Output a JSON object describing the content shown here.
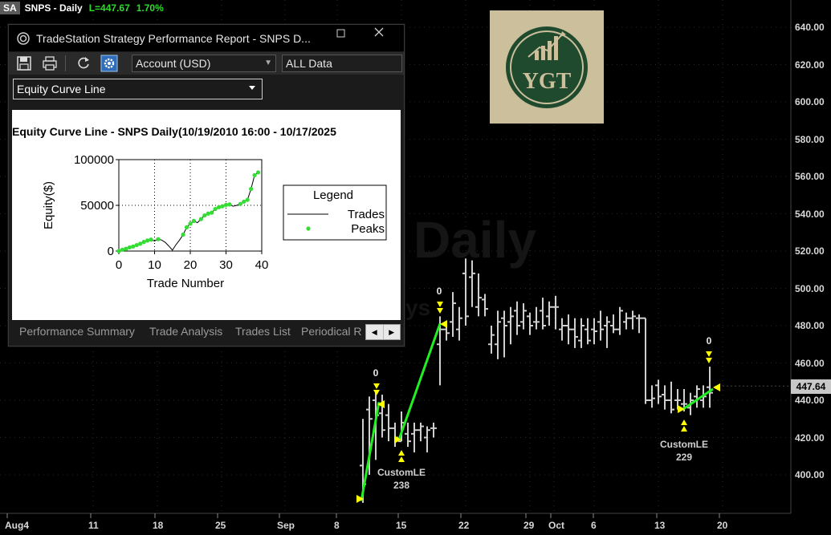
{
  "chart_header": {
    "badge": "SA",
    "symbol": "SNPS - Daily",
    "last": "L=447.67",
    "change": "1.70%"
  },
  "price_axis": [
    "640.00",
    "620.00",
    "600.00",
    "580.00",
    "560.00",
    "540.00",
    "520.00",
    "500.00",
    "480.00",
    "460.00",
    "440.00",
    "420.00",
    "400.00"
  ],
  "current_price": "447.64",
  "date_axis": [
    "Aug4",
    "11",
    "18",
    "25",
    "Sep",
    "8",
    "15",
    "22",
    "29",
    "Oct",
    "6",
    "13",
    "20"
  ],
  "watermark": "Daily",
  "watermark2": "ys",
  "logo_text": "YGT",
  "signals": [
    {
      "label": "CustomLE",
      "qty": "238",
      "zero": "0"
    },
    {
      "label": "",
      "qty": "",
      "zero": "0"
    },
    {
      "label": "CustomLE",
      "qty": "229",
      "zero": "0"
    }
  ],
  "window": {
    "title": "TradeStation Strategy Performance Report - SNPS D...",
    "account": "Account (USD)",
    "data_range": "ALL Data",
    "curve_type": "Equity Curve Line",
    "tabs": [
      "Performance Summary",
      "Trade Analysis",
      "Trades List",
      "Periodical R"
    ]
  },
  "colors": {
    "peak": "#33dd33",
    "entry_line": "#22ee22",
    "arrow": "#ffff00",
    "bar": "#cccccc"
  },
  "chart_data": {
    "type": "line",
    "title": "Equity Curve Line - SNPS Daily(10/19/2010 16:00 - 10/17/2025",
    "xlabel": "Trade Number",
    "ylabel": "Equity($)",
    "xlim": [
      0,
      40
    ],
    "ylim": [
      0,
      100000
    ],
    "xticks": [
      "0",
      "10",
      "20",
      "30",
      "40"
    ],
    "yticks": [
      "0",
      "50000",
      "100000"
    ],
    "legend_title": "Legend",
    "legend_placement": "right",
    "series": [
      {
        "name": "Trades",
        "x": [
          0,
          1,
          2,
          3,
          4,
          5,
          6,
          7,
          8,
          9,
          10,
          11,
          12,
          13,
          14,
          15,
          16,
          17,
          18,
          19,
          20,
          21,
          22,
          23,
          24,
          25,
          26,
          27,
          28,
          29,
          30,
          31,
          32,
          33,
          34,
          35,
          36,
          37,
          38,
          39
        ],
        "values": [
          0,
          1500,
          2500,
          4000,
          5000,
          6500,
          8000,
          10000,
          11500,
          12500,
          11000,
          13000,
          12000,
          9500,
          5500,
          1000,
          7000,
          12000,
          18000,
          26000,
          30000,
          33000,
          31000,
          35000,
          39000,
          41000,
          42000,
          46000,
          48000,
          49000,
          50500,
          51000,
          49000,
          50000,
          51500,
          54000,
          56000,
          68000,
          83000,
          86000
        ]
      },
      {
        "name": "Peaks",
        "x": [
          0,
          1,
          2,
          3,
          4,
          5,
          6,
          7,
          8,
          9,
          11,
          18,
          19,
          20,
          21,
          23,
          24,
          25,
          26,
          27,
          28,
          29,
          30,
          31,
          34,
          35,
          36,
          37,
          38,
          39
        ],
        "values": [
          0,
          1500,
          2500,
          4000,
          5000,
          6500,
          8000,
          10000,
          11500,
          12500,
          13000,
          18000,
          26000,
          30000,
          33000,
          35000,
          39000,
          41000,
          42000,
          46000,
          48000,
          49000,
          50500,
          51000,
          51500,
          54000,
          56000,
          68000,
          83000,
          86000
        ]
      }
    ]
  }
}
